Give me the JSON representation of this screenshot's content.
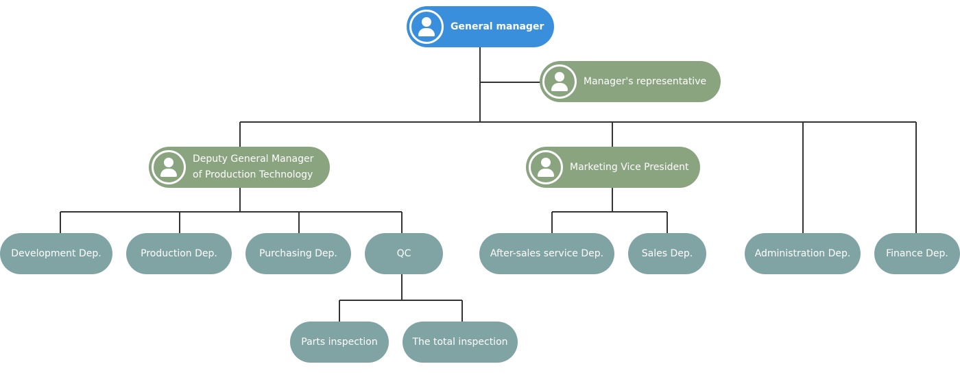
{
  "diagram": {
    "type": "org-chart",
    "colors": {
      "top_node": "#3a8fdc",
      "person_node": "#89a47f",
      "department_node": "#80a4a3",
      "connector": "#333333"
    },
    "nodes": {
      "general_manager": {
        "label": "General manager",
        "icon": "person-icon"
      },
      "managers_rep": {
        "label": "Manager's representative",
        "icon": "person-icon"
      },
      "deputy_gm": {
        "label_line1": "Deputy General Manager",
        "label_line2": "of Production Technology",
        "icon": "person-icon"
      },
      "marketing_vp": {
        "label": "Marketing Vice President",
        "icon": "person-icon"
      },
      "development": {
        "label": "Development Dep."
      },
      "production": {
        "label": "Production Dep."
      },
      "purchasing": {
        "label": "Purchasing Dep."
      },
      "qc": {
        "label": "QC"
      },
      "after_sales": {
        "label": "After-sales service Dep."
      },
      "sales": {
        "label": "Sales Dep."
      },
      "administration": {
        "label": "Administration Dep."
      },
      "finance": {
        "label": "Finance Dep."
      },
      "parts_inspection": {
        "label": "Parts inspection"
      },
      "total_inspection": {
        "label": "The total inspection"
      }
    },
    "edges": [
      [
        "general_manager",
        "managers_rep"
      ],
      [
        "general_manager",
        "deputy_gm"
      ],
      [
        "general_manager",
        "marketing_vp"
      ],
      [
        "general_manager",
        "administration"
      ],
      [
        "general_manager",
        "finance"
      ],
      [
        "deputy_gm",
        "development"
      ],
      [
        "deputy_gm",
        "production"
      ],
      [
        "deputy_gm",
        "purchasing"
      ],
      [
        "deputy_gm",
        "qc"
      ],
      [
        "marketing_vp",
        "after_sales"
      ],
      [
        "marketing_vp",
        "sales"
      ],
      [
        "qc",
        "parts_inspection"
      ],
      [
        "qc",
        "total_inspection"
      ]
    ]
  }
}
